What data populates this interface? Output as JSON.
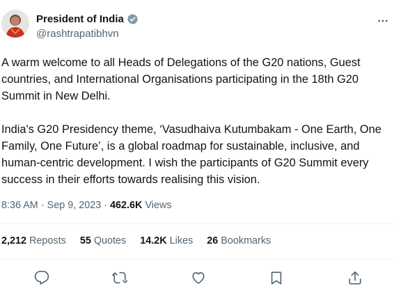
{
  "author": {
    "name": "President of India",
    "handle": "@rashtrapatibhvn",
    "verified": true,
    "badge_color": "#829aab"
  },
  "tweet": {
    "paragraphs": [
      "A warm welcome to all Heads of Delegations of the G20 nations, Guest countries, and International Organisations participating in the 18th G20 Summit in New Delhi.",
      "India's G20 Presidency theme, ‘Vasudhaiva Kutumbakam - One Earth, One Family, One Future’, is a global roadmap for sustainable, inclusive, and human-centric development. I wish the participants of G20 Summit every success in their efforts towards realising this vision."
    ]
  },
  "meta": {
    "time": "8:36 AM",
    "separator": "·",
    "date": "Sep 9, 2023",
    "views_count": "462.6K",
    "views_label": "Views"
  },
  "stats": [
    {
      "count": "2,212",
      "label": "Reposts"
    },
    {
      "count": "55",
      "label": "Quotes"
    },
    {
      "count": "14.2K",
      "label": "Likes"
    },
    {
      "count": "26",
      "label": "Bookmarks"
    }
  ],
  "actions": [
    "reply-icon",
    "repost-icon",
    "like-icon",
    "bookmark-icon",
    "share-icon"
  ],
  "colors": {
    "text": "#0f1419",
    "secondary": "#536471",
    "divider": "#eff3f4"
  }
}
